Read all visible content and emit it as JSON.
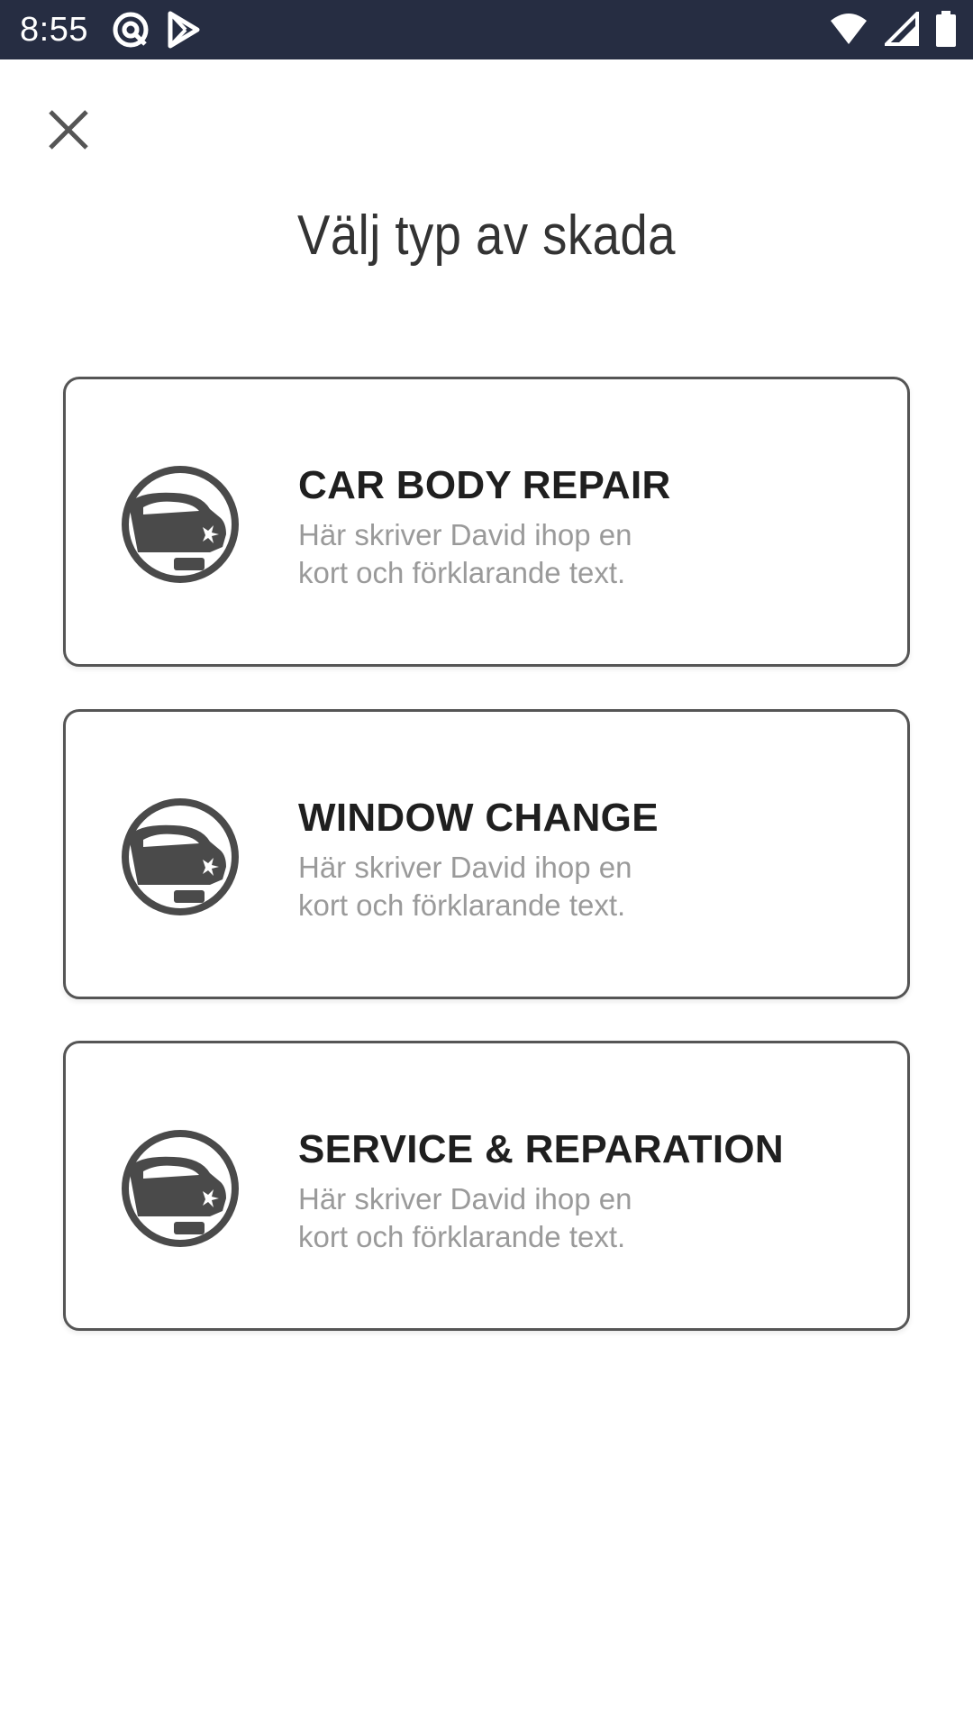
{
  "status_bar": {
    "time": "8:55",
    "left_icons": [
      "at-sign-icon",
      "play-store-icon"
    ],
    "right_icons": [
      "wifi-icon",
      "signal-icon",
      "battery-icon"
    ]
  },
  "header": {
    "close_icon": "close-icon",
    "title": "Välj typ av skada"
  },
  "cards": [
    {
      "title": "CAR BODY REPAIR",
      "description": "Här skriver David ihop en kort och förklarande text.",
      "icon": "car-icon"
    },
    {
      "title": "WINDOW CHANGE",
      "description": "Här skriver David ihop en kort och förklarande text.",
      "icon": "car-icon"
    },
    {
      "title": "SERVICE & REPARATION",
      "description": "Här skriver David ihop en kort och förklarande text.",
      "icon": "car-icon"
    }
  ],
  "colors": {
    "status_bar": "#262d42",
    "card_border": "#555555",
    "icon": "#4a4a4a",
    "title_text": "#1f1f1f",
    "desc_text": "#9a9a9a"
  }
}
